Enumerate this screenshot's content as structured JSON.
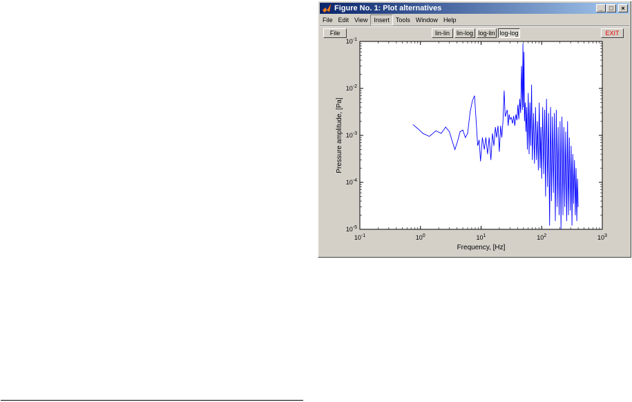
{
  "window": {
    "title": "Figure No. 1: Plot alternatives",
    "minimize_glyph": "_",
    "maximize_glyph": "□",
    "close_glyph": "×"
  },
  "menu": {
    "items": [
      {
        "label": "File"
      },
      {
        "label": "Edit"
      },
      {
        "label": "View"
      },
      {
        "label": "Insert"
      },
      {
        "label": "Tools"
      },
      {
        "label": "Window"
      },
      {
        "label": "Help"
      }
    ],
    "active": "Insert"
  },
  "toolbar": {
    "file_label": "File",
    "lin_lin_label": "lin-lin",
    "lin_log_label": "lin-log",
    "log_lin_label": "log-lin",
    "log_log_label": "log-log",
    "exit_label": "EXIT",
    "pressed": "log-log"
  },
  "chart_data": {
    "type": "line",
    "xscale": "log",
    "yscale": "log",
    "xlim": [
      0.1,
      1000
    ],
    "ylim": [
      1e-05,
      0.1
    ],
    "xlabel": "Frequency, [Hz]",
    "ylabel": "Pressure amplitude, [Pa]",
    "x_tick_labels": [
      "10-1",
      "100",
      "101",
      "102",
      "103"
    ],
    "y_tick_labels": [
      "10-5",
      "10-4",
      "10-3",
      "10-2",
      "10-1"
    ],
    "grid": false,
    "series": [
      {
        "color": "#0000ff",
        "x": [
          0.75,
          0.9,
          1.1,
          1.4,
          1.8,
          2.2,
          2.6,
          3.0,
          3.3,
          3.7,
          4.1,
          4.5,
          5.0,
          5.5,
          6.0,
          6.6,
          7.2,
          7.8,
          8.3,
          8.8,
          9.3,
          9.8,
          10.5,
          11.3,
          12.0,
          12.8,
          13.6,
          14.5,
          15.4,
          16.3,
          17.2,
          18.0,
          19.0,
          20.0,
          21.0,
          22.0,
          23.0,
          24.0,
          25.0,
          26.0,
          27.0,
          28.0,
          29.0,
          30.0,
          31.5,
          33.0,
          34.5,
          36.0,
          37.5,
          39.0,
          40.5,
          42.0,
          43.5,
          45.0,
          46.5,
          48.0,
          49.0,
          50.0,
          51.0,
          52.0,
          53.5,
          55.0,
          56.5,
          58.0,
          60.0,
          62.0,
          64.0,
          66.0,
          68.0,
          70.0,
          73.0,
          76.0,
          79.0,
          82.0,
          85.0,
          88.0,
          91.0,
          94.0,
          97.0,
          100,
          104,
          108,
          112,
          116,
          120,
          125,
          130,
          135,
          140,
          145,
          150,
          156,
          162,
          168,
          174,
          180,
          187,
          194,
          201,
          208,
          216,
          224,
          232,
          240,
          249,
          258,
          267,
          276,
          286,
          296,
          306,
          316,
          326,
          336,
          347,
          358,
          369,
          380,
          390,
          400
        ],
        "y": [
          0.0017,
          0.0014,
          0.0011,
          0.00095,
          0.00125,
          0.0011,
          0.0015,
          0.0012,
          0.0008,
          0.0005,
          0.00075,
          0.0012,
          0.0013,
          0.0009,
          0.0011,
          0.0032,
          0.0055,
          0.007,
          0.002,
          0.0006,
          0.0008,
          0.00028,
          0.0009,
          0.0005,
          0.0009,
          0.0004,
          0.0009,
          0.0003,
          0.0011,
          0.0006,
          0.0015,
          0.0009,
          0.0016,
          0.00045,
          0.0016,
          0.0009,
          0.002,
          0.009,
          0.0025,
          0.003,
          0.0035,
          0.0016,
          0.0028,
          0.0022,
          0.0024,
          0.0018,
          0.0026,
          0.0016,
          0.0028,
          0.0021,
          0.0045,
          0.0022,
          0.006,
          0.003,
          0.03,
          0.0035,
          0.09,
          0.004,
          0.06,
          0.002,
          0.005,
          0.0012,
          0.004,
          0.0005,
          0.008,
          0.0004,
          0.005,
          0.0006,
          0.012,
          0.0003,
          0.003,
          0.00025,
          0.004,
          0.0003,
          0.002,
          0.00018,
          0.005,
          0.0002,
          0.0015,
          0.00012,
          0.004,
          0.00015,
          0.0035,
          5e-05,
          0.006,
          8e-05,
          0.003,
          1.2e-05,
          0.004,
          4e-05,
          0.0025,
          6e-05,
          0.003,
          1.5e-05,
          0.0035,
          3e-05,
          0.0015,
          2e-05,
          0.002,
          1e-05,
          0.0025,
          2e-05,
          0.0015,
          3e-05,
          0.0012,
          1.5e-05,
          0.002,
          2e-05,
          0.0009,
          2.5e-05,
          0.0006,
          1.2e-05,
          0.0004,
          3.5e-05,
          0.0003,
          2e-05,
          0.0002,
          1.5e-05,
          0.00012,
          3e-05
        ]
      }
    ]
  }
}
